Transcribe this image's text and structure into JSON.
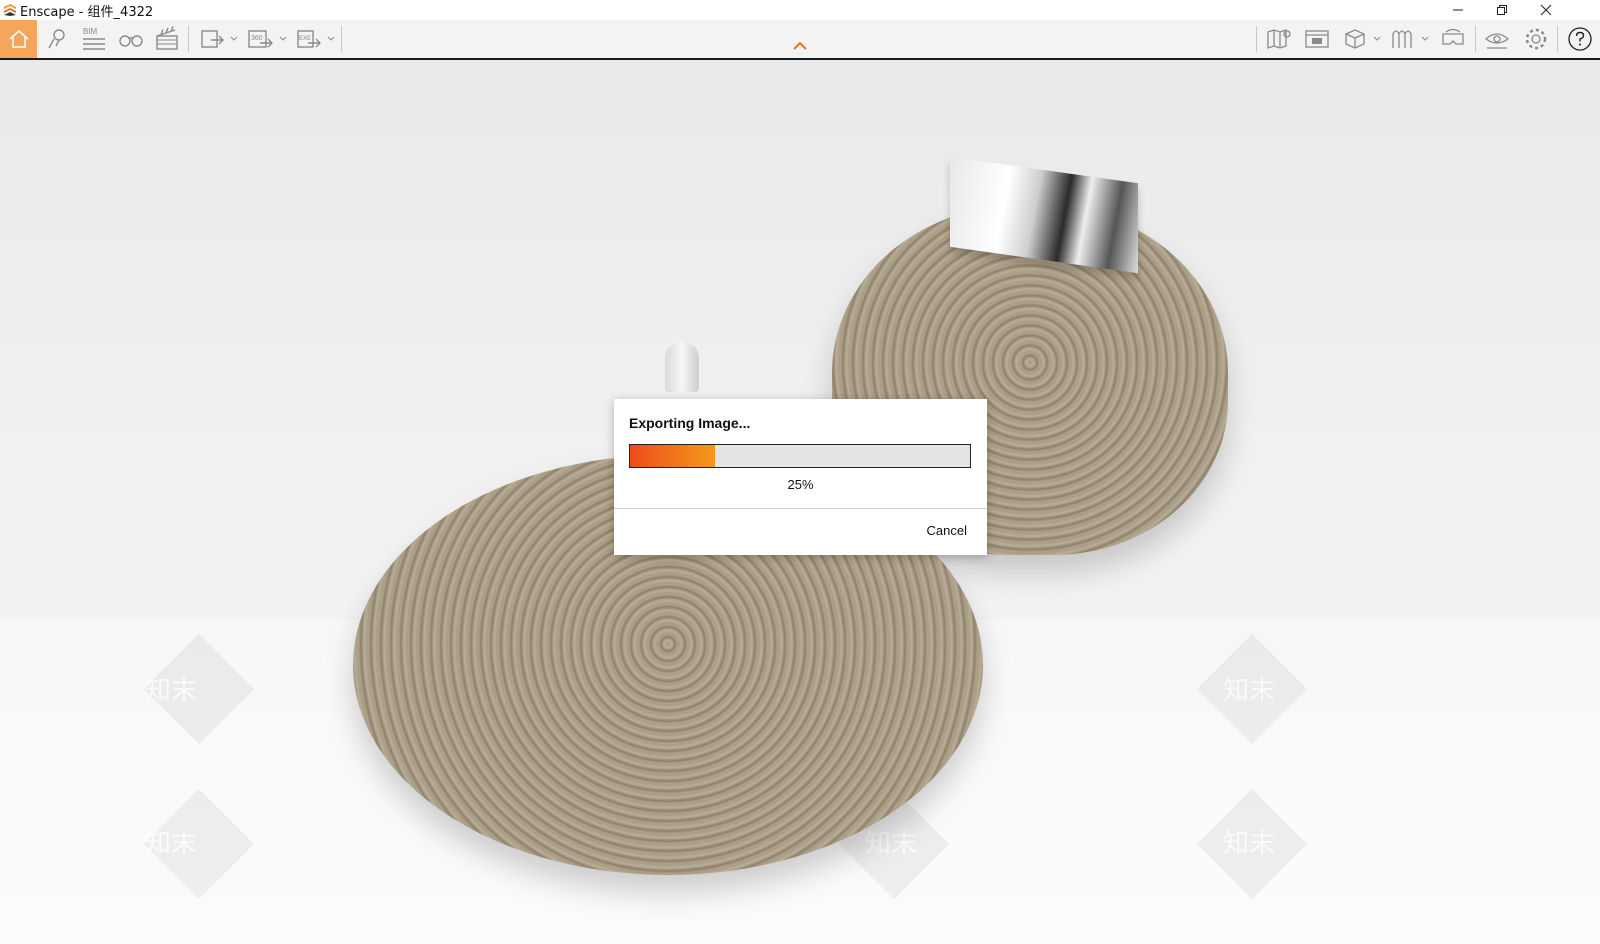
{
  "window": {
    "title": "Enscape - 组件_4322",
    "icon": "enscape-logo-icon",
    "controls": [
      "minimize-icon",
      "restore-icon",
      "close-icon"
    ]
  },
  "toolbar": {
    "left_buttons": [
      "home-icon",
      "location-pin-icon",
      "bim-icon",
      "binoculars-icon",
      "clapperboard-icon",
      "export-image-icon",
      "export-360-icon",
      "export-exe-icon"
    ],
    "bim_label": "BIM",
    "pano_label": "360",
    "exe_label": "EXE",
    "center": "collapse-chevron-icon",
    "right_buttons": [
      "map-icon",
      "asset-library-icon",
      "cube-view-icon",
      "material-icon",
      "vr-headset-icon",
      "visibility-icon",
      "settings-icon",
      "help-icon"
    ],
    "accent_color": "#f5a65a"
  },
  "watermark_text": "知末",
  "dialog": {
    "title": "Exporting Image...",
    "progress_fraction": 0.25,
    "percent_label": "25%",
    "cancel_label": "Cancel",
    "progress_colors": [
      "#ee4b1c",
      "#f39a19"
    ]
  }
}
